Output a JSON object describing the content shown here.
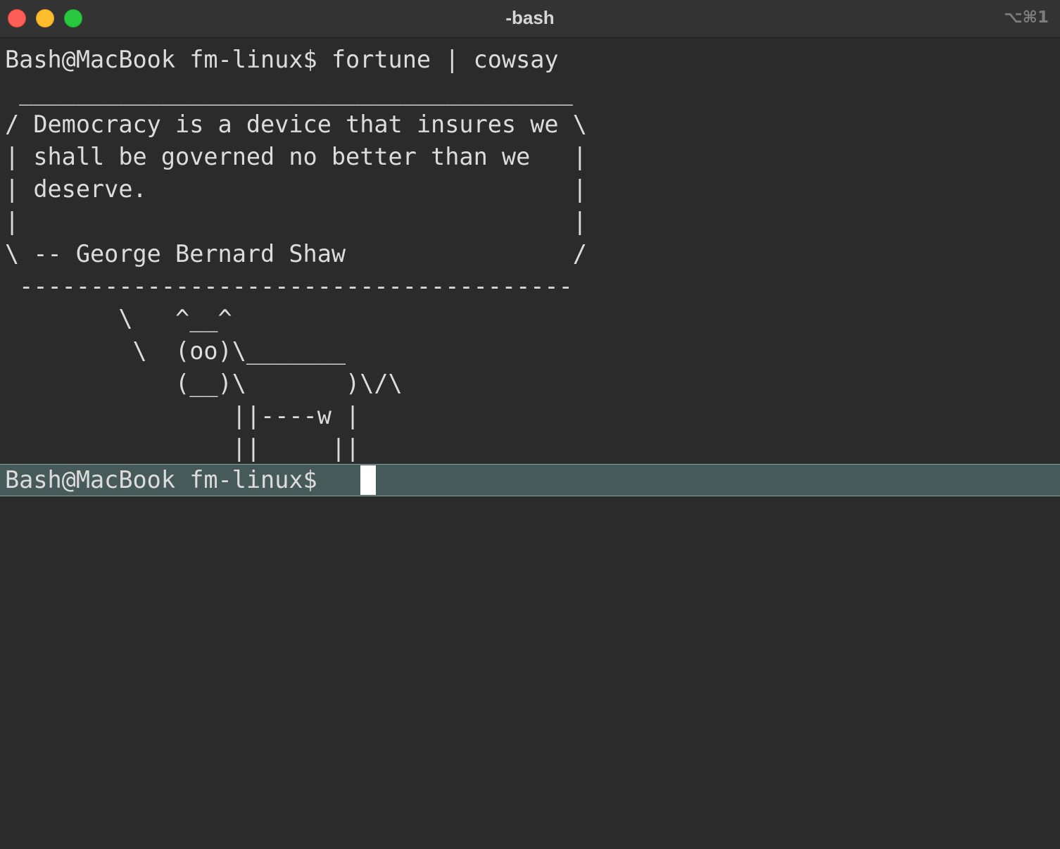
{
  "window": {
    "title": "-bash",
    "shortcut": "⌥⌘1"
  },
  "terminal": {
    "command_line": "Bash@MacBook fm-linux$ fortune | cowsay",
    "output": [
      " _______________________________________",
      "/ Democracy is a device that insures we \\",
      "| shall be governed no better than we   |",
      "| deserve.                              |",
      "|                                       |",
      "\\ -- George Bernard Shaw                /",
      " ---------------------------------------",
      "        \\   ^__^",
      "         \\  (oo)\\_______",
      "            (__)\\       )\\/\\",
      "                ||----w |",
      "                ||     ||"
    ],
    "current_prompt": "Bash@MacBook fm-linux$ "
  },
  "colors": {
    "background": "#2b2b2b",
    "text": "#dcdcdc",
    "current_line_highlight": "#465a5a",
    "cursor": "#ffffff"
  }
}
